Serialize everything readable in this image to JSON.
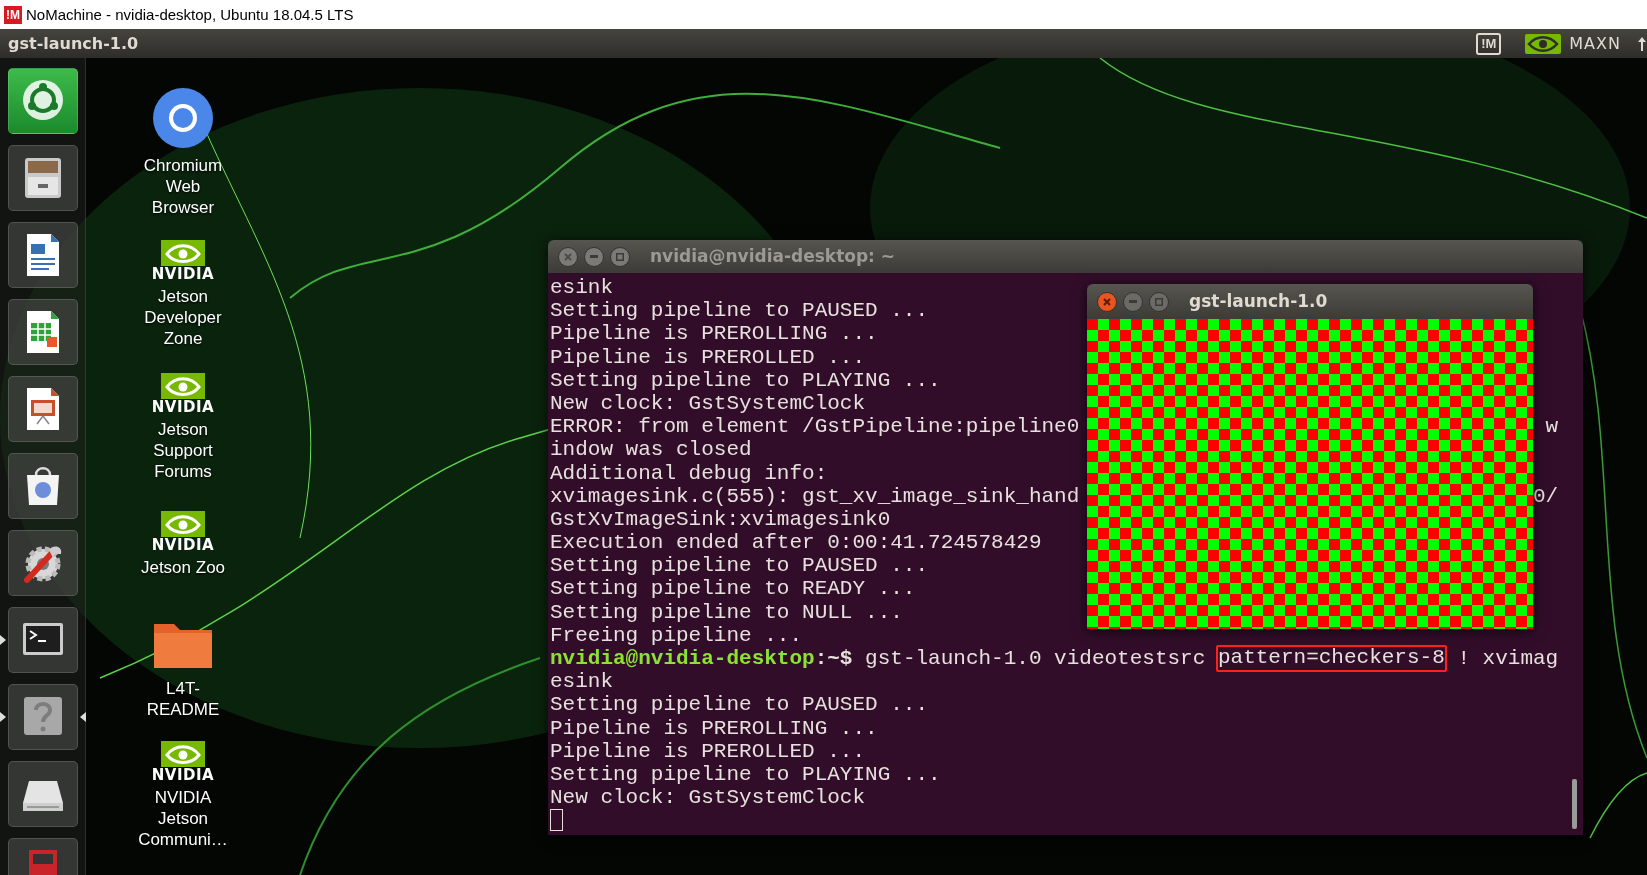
{
  "client_window": {
    "logo_text": "!M",
    "title": "NoMachine - nvidia-desktop, Ubuntu 18.04.5 LTS"
  },
  "top_panel": {
    "title": "gst-launch-1.0",
    "logo_text": "!M",
    "indicator": "MAXN"
  },
  "launcher": {
    "items": [
      {
        "selected": true,
        "running": false,
        "focused": false
      },
      {
        "selected": false,
        "running": false,
        "focused": false
      },
      {
        "selected": false,
        "running": false,
        "focused": false
      },
      {
        "selected": false,
        "running": false,
        "focused": false
      },
      {
        "selected": false,
        "running": false,
        "focused": false
      },
      {
        "selected": false,
        "running": false,
        "focused": false
      },
      {
        "selected": false,
        "running": false,
        "focused": false
      },
      {
        "selected": false,
        "running": true,
        "focused": false
      },
      {
        "selected": false,
        "running": true,
        "focused": true
      },
      {
        "selected": false,
        "running": false,
        "focused": false
      },
      {
        "selected": false,
        "running": false,
        "focused": false
      }
    ]
  },
  "desktop_icons": [
    {
      "kind": "browser",
      "label": "Chromium Web Browser"
    },
    {
      "kind": "nvidia",
      "logo_text": "NVIDIA",
      "label": "Jetson Developer Zone"
    },
    {
      "kind": "nvidia",
      "logo_text": "NVIDIA",
      "label": "Jetson Support Forums"
    },
    {
      "kind": "nvidia",
      "logo_text": "NVIDIA",
      "label": "Jetson Zoo"
    },
    {
      "kind": "folder",
      "label": "L4T-README"
    },
    {
      "kind": "nvidia",
      "logo_text": "NVIDIA",
      "label": "NVIDIA Jetson Communi…"
    }
  ],
  "terminal": {
    "title": "nvidia@nvidia-desktop: ~",
    "focused": false,
    "lines": [
      {
        "kind": "output",
        "text": "esink"
      },
      {
        "kind": "output",
        "text": "Setting pipeline to PAUSED ..."
      },
      {
        "kind": "output",
        "text": "Pipeline is PREROLLING ..."
      },
      {
        "kind": "output",
        "text": "Pipeline is PREROLLED ..."
      },
      {
        "kind": "output",
        "text": "Setting pipeline to PLAYING ..."
      },
      {
        "kind": "output",
        "text": "New clock: GstSystemClock"
      },
      {
        "kind": "output",
        "text": "ERROR: from element /GstPipeline:pipeline0",
        "right": "w"
      },
      {
        "kind": "output",
        "text": "indow was closed"
      },
      {
        "kind": "output",
        "text": "Additional debug info:"
      },
      {
        "kind": "output",
        "text": "xvimagesink.c(555): gst_xv_image_sink_hand",
        "right": "0/"
      },
      {
        "kind": "output",
        "text": "GstXvImageSink:xvimagesink0"
      },
      {
        "kind": "output",
        "text": "Execution ended after 0:00:41.724578429"
      },
      {
        "kind": "output",
        "text": "Setting pipeline to PAUSED ..."
      },
      {
        "kind": "output",
        "text": "Setting pipeline to READY ..."
      },
      {
        "kind": "output",
        "text": "Setting pipeline to NULL ..."
      },
      {
        "kind": "output",
        "text": "Freeing pipeline ..."
      },
      {
        "kind": "prompt",
        "user": "nvidia@nvidia-desktop",
        "path": ":~$",
        "command": "gst-launch-1.0 videotestsrc",
        "highlight": "pattern=checkers-8",
        "rest": "! xvimag"
      },
      {
        "kind": "output",
        "text": "esink"
      },
      {
        "kind": "output",
        "text": "Setting pipeline to PAUSED ..."
      },
      {
        "kind": "output",
        "text": "Pipeline is PREROLLING ..."
      },
      {
        "kind": "output",
        "text": "Pipeline is PREROLLED ..."
      },
      {
        "kind": "output",
        "text": "Setting pipeline to PLAYING ..."
      },
      {
        "kind": "output",
        "text": "New clock: GstSystemClock"
      },
      {
        "kind": "cursor"
      }
    ]
  },
  "video_window": {
    "title": "gst-launch-1.0",
    "focused": true
  }
}
